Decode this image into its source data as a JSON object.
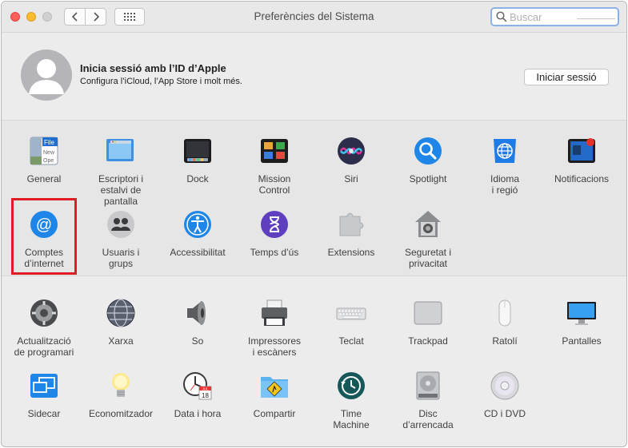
{
  "window": {
    "title": "Preferències del Sistema",
    "search_placeholder": "Buscar"
  },
  "apple_id": {
    "title": "Inicia sessió amb l’ID d’Apple",
    "subtitle": "Configura l’iCloud, l’App Store i molt més.",
    "button": "Iniciar sessió"
  },
  "section1_row1": [
    {
      "id": "general",
      "l1": "General",
      "l2": "",
      "icon": "general-icon"
    },
    {
      "id": "desktop",
      "l1": "Escriptori i",
      "l2": "estalvi de pantalla",
      "icon": "desktop-screensaver-icon"
    },
    {
      "id": "dock",
      "l1": "Dock",
      "l2": "",
      "icon": "dock-icon"
    },
    {
      "id": "mission",
      "l1": "Mission",
      "l2": "Control",
      "icon": "mission-control-icon"
    },
    {
      "id": "siri",
      "l1": "Siri",
      "l2": "",
      "icon": "siri-icon"
    },
    {
      "id": "spotlight",
      "l1": "Spotlight",
      "l2": "",
      "icon": "spotlight-icon"
    },
    {
      "id": "language",
      "l1": "Idioma",
      "l2": "i regió",
      "icon": "language-region-icon"
    },
    {
      "id": "notifications",
      "l1": "Notificacions",
      "l2": "",
      "icon": "notifications-icon"
    }
  ],
  "section1_row2": [
    {
      "id": "internet",
      "l1": "Comptes",
      "l2": "d’internet",
      "icon": "internet-accounts-icon"
    },
    {
      "id": "users",
      "l1": "Usuaris i",
      "l2": "grups",
      "icon": "users-groups-icon"
    },
    {
      "id": "accessibility",
      "l1": "Accessibilitat",
      "l2": "",
      "icon": "accessibility-icon"
    },
    {
      "id": "screentime",
      "l1": "Temps d’ús",
      "l2": "",
      "icon": "screen-time-icon"
    },
    {
      "id": "extensions",
      "l1": "Extensions",
      "l2": "",
      "icon": "extensions-icon"
    },
    {
      "id": "security",
      "l1": "Seguretat i",
      "l2": "privacitat",
      "icon": "security-privacy-icon"
    }
  ],
  "section2_row1": [
    {
      "id": "update",
      "l1": "Actualització",
      "l2": "de programari",
      "icon": "software-update-icon"
    },
    {
      "id": "network",
      "l1": "Xarxa",
      "l2": "",
      "icon": "network-icon"
    },
    {
      "id": "sound",
      "l1": "So",
      "l2": "",
      "icon": "sound-icon"
    },
    {
      "id": "printers",
      "l1": "Impressores",
      "l2": "i escàners",
      "icon": "printers-scanners-icon"
    },
    {
      "id": "keyboard",
      "l1": "Teclat",
      "l2": "",
      "icon": "keyboard-icon"
    },
    {
      "id": "trackpad",
      "l1": "Trackpad",
      "l2": "",
      "icon": "trackpad-icon"
    },
    {
      "id": "mouse",
      "l1": "Ratolí",
      "l2": "",
      "icon": "mouse-icon"
    },
    {
      "id": "displays",
      "l1": "Pantalles",
      "l2": "",
      "icon": "displays-icon"
    }
  ],
  "section2_row2": [
    {
      "id": "sidecar",
      "l1": "Sidecar",
      "l2": "",
      "icon": "sidecar-icon"
    },
    {
      "id": "energy",
      "l1": "Economitzador",
      "l2": "",
      "icon": "energy-saver-icon"
    },
    {
      "id": "datetime",
      "l1": "Data i hora",
      "l2": "",
      "icon": "date-time-icon"
    },
    {
      "id": "sharing",
      "l1": "Compartir",
      "l2": "",
      "icon": "sharing-icon"
    },
    {
      "id": "timemachine",
      "l1": "Time",
      "l2": "Machine",
      "icon": "time-machine-icon"
    },
    {
      "id": "startup",
      "l1": "Disc",
      "l2": "d’arrencada",
      "icon": "startup-disk-icon"
    },
    {
      "id": "cddvd",
      "l1": "CD i DVD",
      "l2": "",
      "icon": "cd-dvd-icon"
    }
  ],
  "icon_text": {
    "general_file": "File",
    "general_new": "New",
    "general_ope": "Ope",
    "calendar_month": "JUL",
    "calendar_day": "18"
  }
}
